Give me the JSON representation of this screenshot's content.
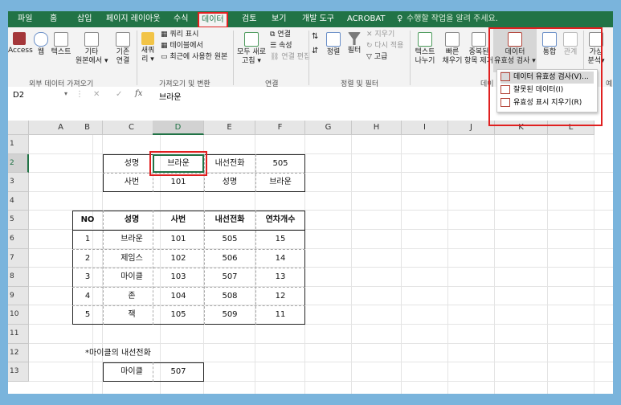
{
  "menu": {
    "tabs": [
      "파일",
      "홈",
      "삽입",
      "페이지 레이아웃",
      "수식",
      "데이터",
      "검토",
      "보기",
      "개발 도구",
      "ACROBAT"
    ],
    "active_tab": "데이터",
    "tell_me": "수행할 작업을 알려 주세요."
  },
  "ribbon": {
    "external_data": {
      "access": "Access",
      "web": "웹",
      "text": "텍스트",
      "other_line1": "기타",
      "other_line2": "원본에서 ▾",
      "existing_line1": "기존",
      "existing_line2": "연결",
      "group_label": "외부 데이터 가져오기"
    },
    "get_transform": {
      "new_query_line1": "새쿼",
      "new_query_line2": "리 ▾",
      "show_queries": "쿼리 표시",
      "from_table": "테이블에서",
      "recent_sources": "최근에 사용한 원본",
      "group_label": "가져오기 및 변환"
    },
    "connections": {
      "refresh_line1": "모두 새로",
      "refresh_line2": "고침 ▾",
      "connections": "연결",
      "properties": "속성",
      "edit_links": "연결 편집",
      "group_label": "연결"
    },
    "sort_filter": {
      "sort": "정렬",
      "filter": "필터",
      "clear": "지우기",
      "reapply": "다시 적용",
      "advanced": "고급",
      "group_label": "정렬 및 필터"
    },
    "data_tools": {
      "text_to_columns_line1": "텍스트",
      "text_to_columns_line2": "나누기",
      "flash_fill_line1": "빠른",
      "flash_fill_line2": "채우기",
      "remove_dup_line1": "중복된",
      "remove_dup_line2": "항목 제거",
      "validation_line1": "데이터",
      "validation_line2": "유효성 검사 ▾",
      "consolidate": "통합",
      "relationships": "관계",
      "group_label_fragment": "데이"
    },
    "forecast": {
      "whatif_line1": "가상",
      "whatif_line2": "분석▾",
      "group_label_fragment": "예"
    }
  },
  "dropdown": {
    "items": [
      "데이터 유효성 검사(V)...",
      "잘못된 데이터(I)",
      "유효성 표시 지우기(R)"
    ]
  },
  "formula_bar": {
    "name_box": "D2",
    "fx": "fx",
    "cancel": "✕",
    "enter": "✓",
    "content": "브라운"
  },
  "sheet": {
    "columns": [
      "A",
      "B",
      "C",
      "D",
      "E",
      "F",
      "G",
      "H",
      "I",
      "J",
      "K",
      "L"
    ],
    "rows": [
      "1",
      "2",
      "3",
      "4",
      "5",
      "6",
      "7",
      "8",
      "9",
      "10",
      "11",
      "12",
      "13"
    ],
    "selected_cell": "D2",
    "lookup": {
      "r2": [
        "성명",
        "브라운",
        "내선전화",
        "505"
      ],
      "r3": [
        "사번",
        "101",
        "성명",
        "브라운"
      ]
    },
    "table": {
      "headers": [
        "NO",
        "성명",
        "사번",
        "내선전화",
        "연차개수"
      ],
      "rows": [
        [
          "1",
          "브라운",
          "101",
          "505",
          "15"
        ],
        [
          "2",
          "제임스",
          "102",
          "506",
          "14"
        ],
        [
          "3",
          "마이클",
          "103",
          "507",
          "13"
        ],
        [
          "4",
          "존",
          "104",
          "508",
          "12"
        ],
        [
          "5",
          "잭",
          "105",
          "509",
          "11"
        ]
      ]
    },
    "note": "*마이클의 내선전화",
    "result": [
      "마이클",
      "507"
    ]
  }
}
